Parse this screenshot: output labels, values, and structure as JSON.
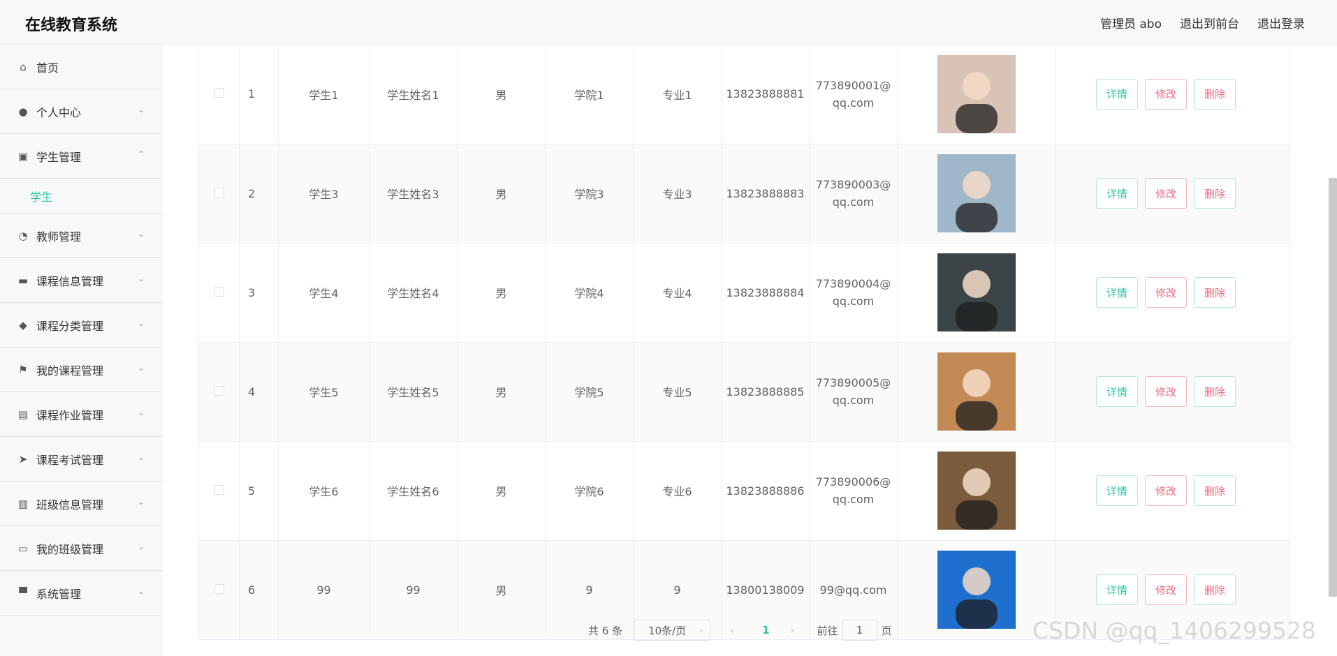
{
  "header": {
    "title": "在线教育系统",
    "user": "管理员 abo",
    "to_front": "退出到前台",
    "logout": "退出登录"
  },
  "sidebar": {
    "items": [
      {
        "label": "首页",
        "icon": "home-icon",
        "chev": ""
      },
      {
        "label": "个人中心",
        "icon": "user-icon",
        "chev": "⌄"
      },
      {
        "label": "学生管理",
        "icon": "clipboard-icon",
        "chev": "⌃"
      },
      {
        "label": "学生",
        "icon": "",
        "chev": ""
      },
      {
        "label": "教师管理",
        "icon": "compass-icon",
        "chev": "⌄"
      },
      {
        "label": "课程信息管理",
        "icon": "monitor-icon",
        "chev": "⌄"
      },
      {
        "label": "课程分类管理",
        "icon": "leaf-icon",
        "chev": "⌄"
      },
      {
        "label": "我的课程管理",
        "icon": "flag-icon",
        "chev": "⌄"
      },
      {
        "label": "课程作业管理",
        "icon": "chat-icon",
        "chev": "⌄"
      },
      {
        "label": "课程考试管理",
        "icon": "send-icon",
        "chev": "⌄"
      },
      {
        "label": "班级信息管理",
        "icon": "books-icon",
        "chev": "⌄"
      },
      {
        "label": "我的班级管理",
        "icon": "presentation-icon",
        "chev": "⌄"
      },
      {
        "label": "系统管理",
        "icon": "desktop-icon",
        "chev": "⌄"
      }
    ]
  },
  "table": {
    "rows": [
      {
        "index": "1",
        "account": "学生1",
        "name": "学生姓名1",
        "gender": "男",
        "college": "学院1",
        "major": "专业1",
        "phone": "13823888881",
        "email1": "773890001@",
        "email2": "qq.com",
        "avatar_color": "#d9c2b6"
      },
      {
        "index": "2",
        "account": "学生3",
        "name": "学生姓名3",
        "gender": "男",
        "college": "学院3",
        "major": "专业3",
        "phone": "13823888883",
        "email1": "773890003@",
        "email2": "qq.com",
        "avatar_color": "#9fb7c9"
      },
      {
        "index": "3",
        "account": "学生4",
        "name": "学生姓名4",
        "gender": "男",
        "college": "学院4",
        "major": "专业4",
        "phone": "13823888884",
        "email1": "773890004@",
        "email2": "qq.com",
        "avatar_color": "#3b4446"
      },
      {
        "index": "4",
        "account": "学生5",
        "name": "学生姓名5",
        "gender": "男",
        "college": "学院5",
        "major": "专业5",
        "phone": "13823888885",
        "email1": "773890005@",
        "email2": "qq.com",
        "avatar_color": "#c48a55"
      },
      {
        "index": "5",
        "account": "学生6",
        "name": "学生姓名6",
        "gender": "男",
        "college": "学院6",
        "major": "专业6",
        "phone": "13823888886",
        "email1": "773890006@",
        "email2": "qq.com",
        "avatar_color": "#7a5c3c"
      },
      {
        "index": "6",
        "account": "99",
        "name": "99",
        "gender": "男",
        "college": "9",
        "major": "9",
        "phone": "13800138009",
        "email1": "99@qq.com",
        "email2": "",
        "avatar_color": "#1f6fcf"
      }
    ],
    "detail_label": "详情",
    "edit_label": "修改",
    "delete_label": "删除"
  },
  "pager": {
    "total": "共 6 条",
    "size": "10条/页",
    "prev": "‹",
    "current": "1",
    "next": "›",
    "goto": "前往",
    "jump_value": "1",
    "page_unit": "页"
  },
  "watermark": "CSDN @qq_1406299528"
}
